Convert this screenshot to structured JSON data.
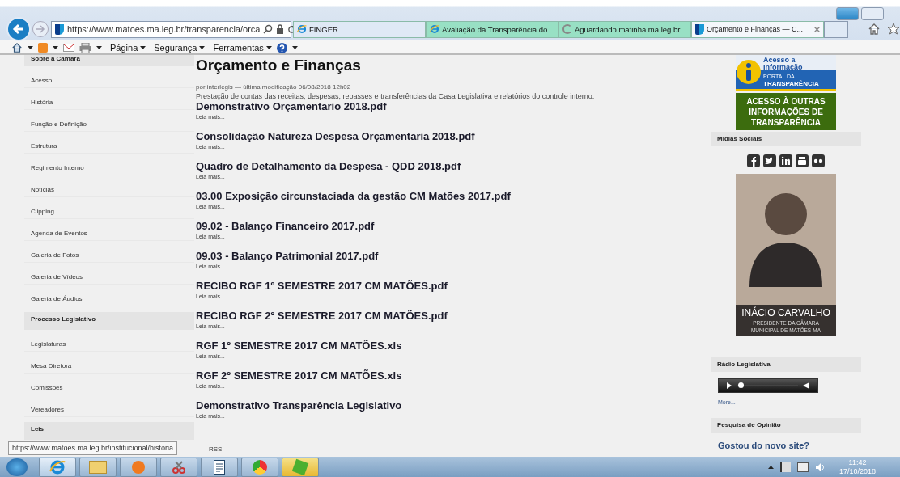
{
  "browser": {
    "address": "https://www.matoes.ma.leg.br/transparencia/orca",
    "tabs": [
      {
        "title": "FINGER",
        "selected": false,
        "kind": "ie"
      },
      {
        "title": "Avaliação da Transparência do...",
        "selected": false,
        "kind": "ie"
      },
      {
        "title": "Aguardando matinha.ma.leg.br",
        "selected": false,
        "kind": "loading"
      },
      {
        "title": "Orçamento e Finanças — C...",
        "selected": true,
        "kind": "site"
      }
    ],
    "commands": [
      "Página",
      "Segurança",
      "Ferramentas"
    ]
  },
  "sidebar": [
    {
      "heading": "Sobre a Câmara",
      "items": [
        "Acesso",
        "História",
        "Função e Definição",
        "Estrutura",
        "Regimento Interno",
        "Notícias",
        "Clipping",
        "Agenda de Eventos",
        "Galeria de Fotos",
        "Galeria de Vídeos",
        "Galeria de Áudios"
      ]
    },
    {
      "heading": "Processo Legislativo",
      "items": [
        "Legislaturas",
        "Mesa Diretora",
        "Comissões",
        "Vereadores"
      ]
    },
    {
      "heading": "Leis"
    }
  ],
  "content": {
    "title": "Orçamento e Finanças",
    "byline": "por interlegis — última modificação 06/08/2018 12h02",
    "description": "Prestação de contas das receitas, despesas, repasses e transferências da Casa Legislativa e relatórios do controle interno.",
    "documents": [
      {
        "title": "Demonstrativo Orçamentario 2018.pdf",
        "more": "Leia mais..."
      },
      {
        "title": "Consolidação Natureza Despesa Orçamentaria 2018.pdf",
        "more": "Leia mais..."
      },
      {
        "title": "Quadro de Detalhamento da Despesa - QDD 2018.pdf",
        "more": "Leia mais..."
      },
      {
        "title": "03.00 Exposição circunstaciada da gestão CM Matões 2017.pdf",
        "more": "Leia mais..."
      },
      {
        "title": "09.02 - Balanço Financeiro 2017.pdf",
        "more": "Leia mais..."
      },
      {
        "title": "09.03 - Balanço Patrimonial 2017.pdf",
        "more": "Leia mais..."
      },
      {
        "title": "RECIBO RGF 1º SEMESTRE 2017 CM MATÕES.pdf",
        "more": "Leia mais..."
      },
      {
        "title": "RECIBO RGF 2º SEMESTRE 2017 CM MATÕES.pdf",
        "more": "Leia mais..."
      },
      {
        "title": "RGF 1º SEMESTRE 2017 CM MATÕES.xls",
        "more": "Leia mais..."
      },
      {
        "title": "RGF 2º SEMESTRE 2017 CM MATÕES.xls",
        "more": "Leia mais..."
      },
      {
        "title": "Demonstrativo Transparência Legislativo",
        "more": "Leia mais..."
      }
    ]
  },
  "right": {
    "portal_banner": {
      "line1": "Acesso a",
      "line2": "Informação",
      "line3": "PORTAL DA",
      "line4": "TRANSPARÊNCIA"
    },
    "other_banner": "ACESSO À OUTRAS INFORMAÇÕES DE TRANSPARÊNCIA",
    "social_heading": "Mídias Sociais",
    "president": {
      "name": "INÁCIO CARVALHO",
      "role1": "PRESIDENTE DA CÂMARA",
      "role2": "MUNICIPAL DE MATÕES-MA"
    },
    "radio_heading": "Rádio Legislativa",
    "player": {
      "level": 0.06
    },
    "more": "More...",
    "poll_heading": "Pesquisa de Opinião",
    "question": "Gostou do novo site?"
  },
  "status_url": "https://www.matoes.ma.leg.br/institucional/historia",
  "rss": "RSS",
  "taskbar": {
    "time": "11:42",
    "date": "17/10/2018"
  }
}
